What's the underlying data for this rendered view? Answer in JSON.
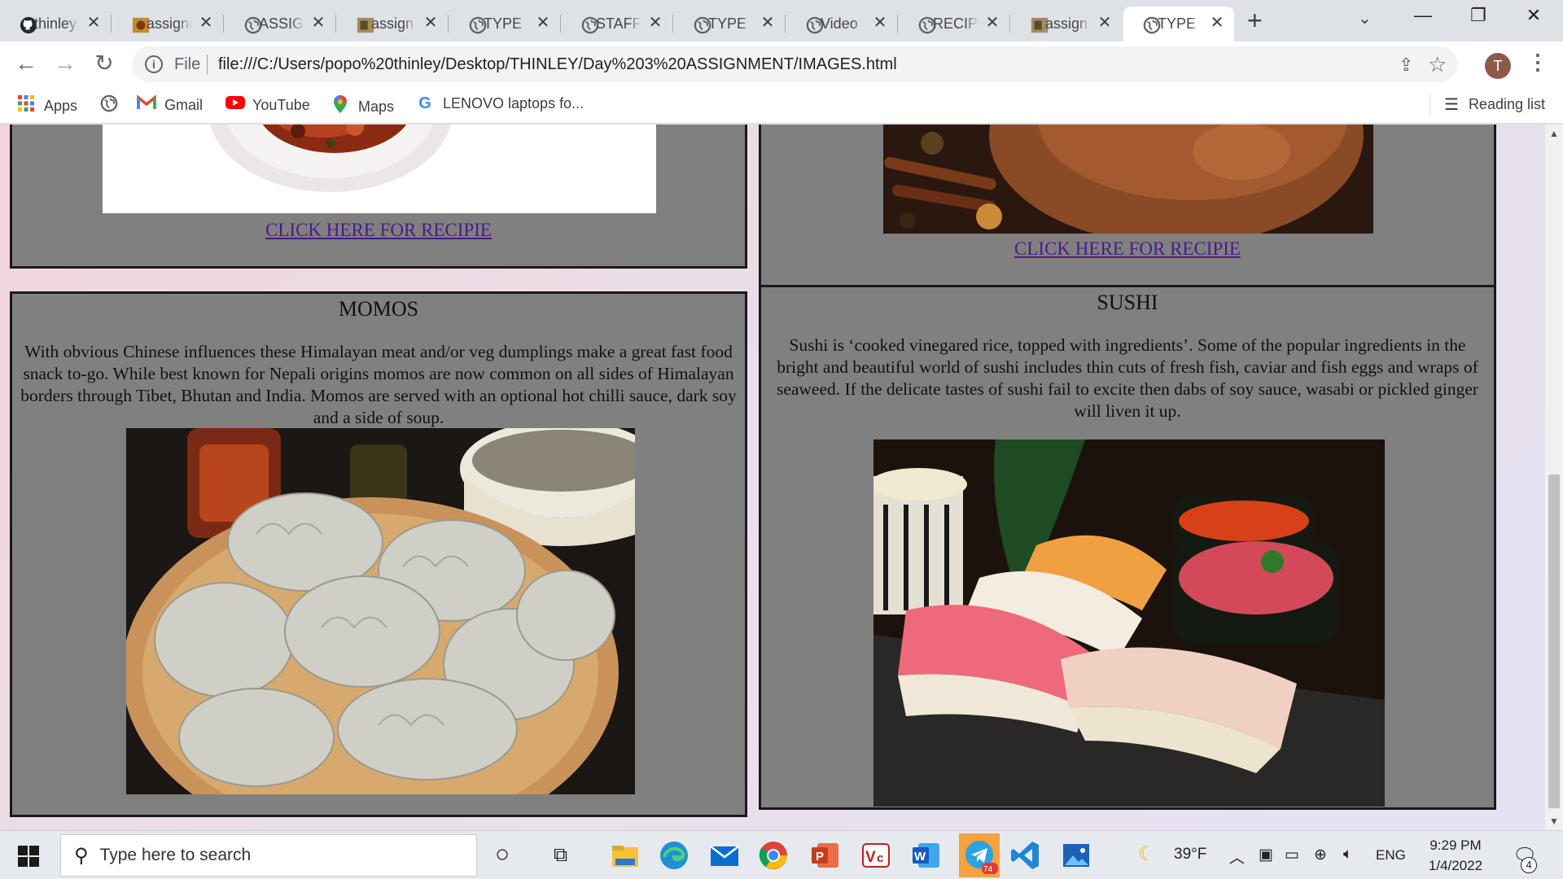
{
  "tabs": [
    {
      "title": "thinley",
      "favicon": "github-icon"
    },
    {
      "title": "assignment",
      "favicon": "image-icon"
    },
    {
      "title": "ASSIGNMENT",
      "favicon": "globe-icon"
    },
    {
      "title": "assign",
      "favicon": "image-icon"
    },
    {
      "title": "TYPE",
      "favicon": "globe-icon"
    },
    {
      "title": "STAFF",
      "favicon": "globe-icon"
    },
    {
      "title": "TYPE",
      "favicon": "globe-icon"
    },
    {
      "title": "Video",
      "favicon": "globe-icon"
    },
    {
      "title": "RECIPE",
      "favicon": "globe-icon"
    },
    {
      "title": "assign",
      "favicon": "image-icon"
    },
    {
      "title": "TYPE",
      "favicon": "globe-icon",
      "active": true
    }
  ],
  "toolbar": {
    "scheme_label": "File",
    "url": "file:///C:/Users/popo%20thinley/Desktop/THINLEY/Day%203%20ASSIGNMENT/IMAGES.html",
    "profile_initial": "T"
  },
  "bookmarks": {
    "items": [
      {
        "label": "Apps",
        "icon": "apps-grid-icon"
      },
      {
        "label": "",
        "icon": "globe-icon"
      },
      {
        "label": "Gmail",
        "icon": "gmail-icon"
      },
      {
        "label": "YouTube",
        "icon": "youtube-icon"
      },
      {
        "label": "Maps",
        "icon": "maps-pin-icon"
      },
      {
        "label": "LENOVO laptops fo...",
        "icon": "google-icon"
      }
    ],
    "reading_list": "Reading list"
  },
  "page": {
    "top_left": {
      "link": "CLICK HERE FOR RECIPIE"
    },
    "top_right": {
      "link": "CLICK HERE FOR RECIPIE"
    },
    "momos": {
      "title": "MOMOS",
      "text": "With obvious Chinese influences these Himalayan meat and/or veg dumplings make a great fast food snack to-go. While best known for Nepali origins momos are now common on all sides of Himalayan borders through Tibet, Bhutan and India. Momos are served with an optional hot chilli sauce, dark soy and a side of soup."
    },
    "sushi": {
      "title": "SUSHI",
      "text": "Sushi is ‘cooked vinegared rice, topped with ingredients’. Some of the popular ingredients in the bright and beautiful world of sushi includes thin cuts of fresh fish, caviar and fish eggs and wraps of seaweed. If the delicate tastes of sushi fail to excite then dabs of soy sauce, wasabi or pickled ginger will liven it up."
    },
    "card_background": "#808080",
    "link_color": "#4a1a8c"
  },
  "taskbar": {
    "search_placeholder": "Type here to search",
    "weather": "39°F",
    "language": "ENG",
    "time": "9:29 PM",
    "date": "1/4/2022",
    "notification_count": "4",
    "telegram_badge": "74",
    "pinned_apps": [
      "cortana-icon",
      "task-view-icon",
      "file-explorer-icon",
      "edge-icon",
      "mail-icon",
      "chrome-icon",
      "powerpoint-icon",
      "vce-icon",
      "word-icon",
      "telegram-icon",
      "vscode-icon",
      "photos-icon"
    ]
  }
}
